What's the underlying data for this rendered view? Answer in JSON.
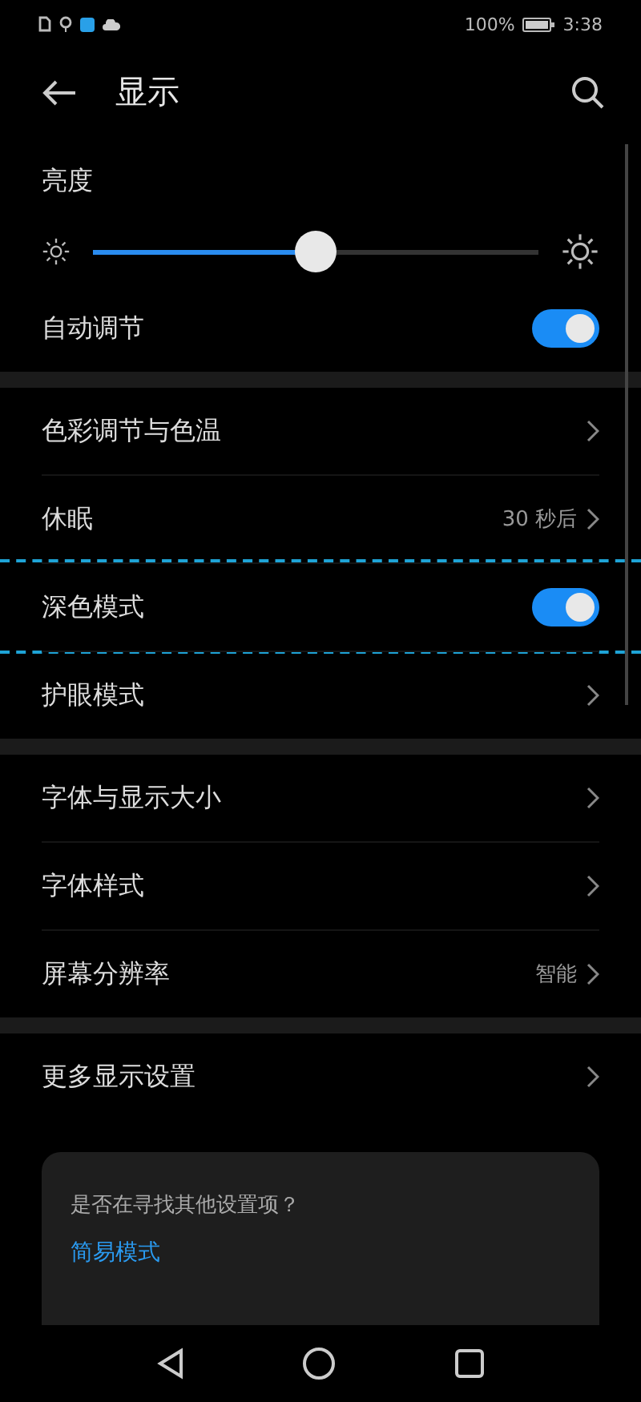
{
  "status_bar": {
    "battery": "100%",
    "time": "3:38"
  },
  "header": {
    "title": "显示"
  },
  "brightness": {
    "label": "亮度",
    "level": 0.5
  },
  "sections": [
    {
      "items": [
        {
          "kind": "toggle",
          "label": "自动调节",
          "on": true,
          "highlighted": false
        }
      ]
    },
    {
      "items": [
        {
          "kind": "link",
          "label": "色彩调节与色温",
          "highlighted": false
        },
        {
          "kind": "link",
          "label": "休眠",
          "value": "30 秒后",
          "highlighted": false
        },
        {
          "kind": "toggle",
          "label": "深色模式",
          "on": true,
          "highlighted": true
        },
        {
          "kind": "link",
          "label": "护眼模式",
          "highlighted": false
        }
      ]
    },
    {
      "items": [
        {
          "kind": "link",
          "label": "字体与显示大小",
          "highlighted": false
        },
        {
          "kind": "link",
          "label": "字体样式",
          "highlighted": false
        },
        {
          "kind": "link",
          "label": "屏幕分辨率",
          "value": "智能",
          "highlighted": false
        }
      ]
    },
    {
      "items": [
        {
          "kind": "link",
          "label": "更多显示设置",
          "highlighted": false
        }
      ]
    }
  ],
  "suggestion_card": {
    "question": "是否在寻找其他设置项？",
    "links": [
      "简易模式"
    ]
  }
}
